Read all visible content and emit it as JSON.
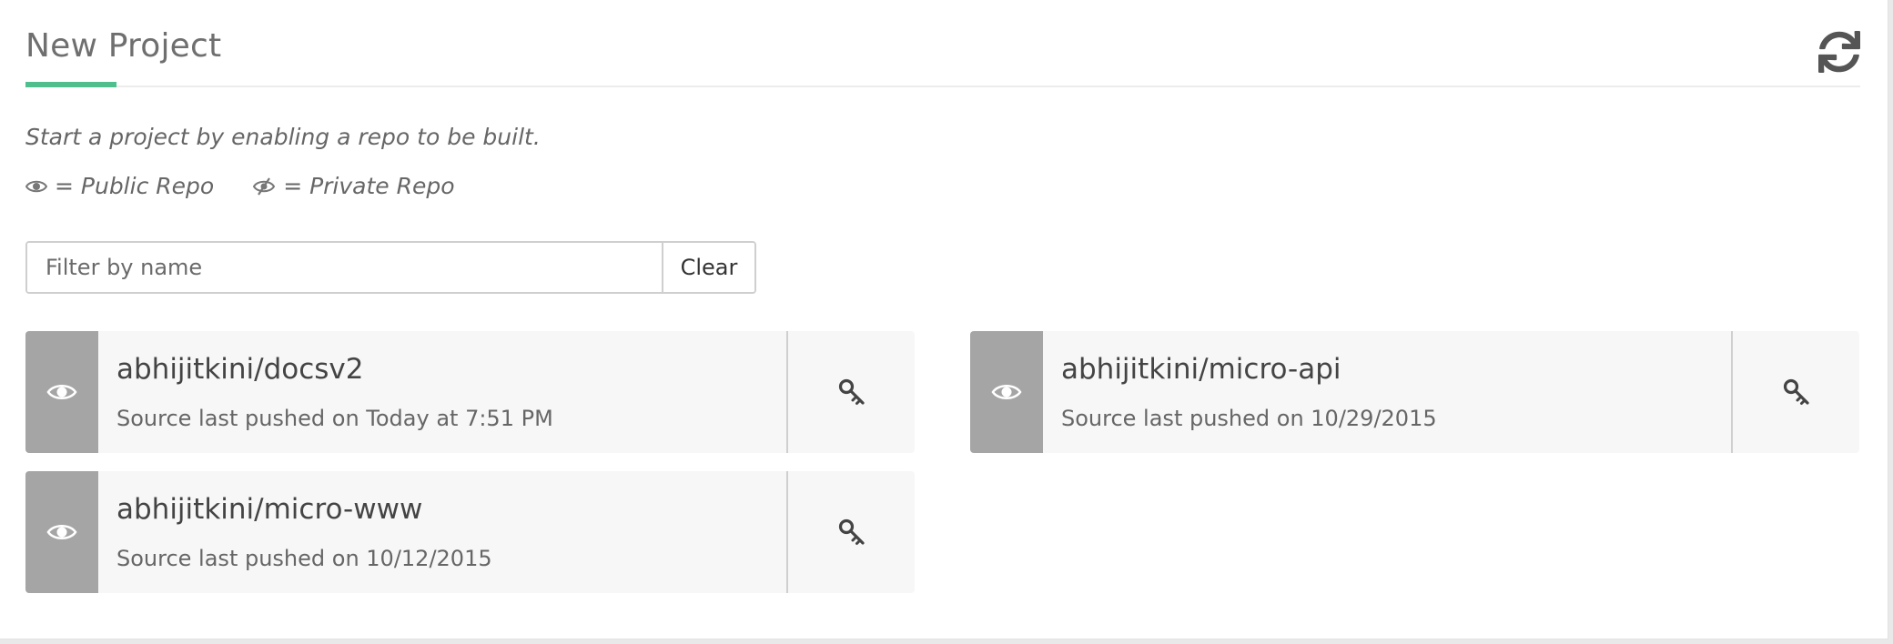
{
  "header": {
    "title": "New Project"
  },
  "intro_text": "Start a project by enabling a repo to be built.",
  "legend": {
    "public_label": "= Public Repo",
    "private_label": "= Private Repo"
  },
  "filter": {
    "placeholder": "Filter by name",
    "value": "",
    "clear_label": "Clear"
  },
  "colors": {
    "accent": "#4fc08d",
    "visibility_bar": "#a5a5a5",
    "card_bg": "#f7f7f7"
  },
  "repos": [
    {
      "name": "abhijitkini/docsv2",
      "pushed": "Source last pushed on Today at 7:51 PM",
      "visibility_icon": "eye-icon",
      "action_icon": "key-icon"
    },
    {
      "name": "abhijitkini/micro-api",
      "pushed": "Source last pushed on 10/29/2015",
      "visibility_icon": "eye-icon",
      "action_icon": "key-icon"
    },
    {
      "name": "abhijitkini/micro-www",
      "pushed": "Source last pushed on 10/12/2015",
      "visibility_icon": "eye-icon",
      "action_icon": "key-icon"
    }
  ]
}
